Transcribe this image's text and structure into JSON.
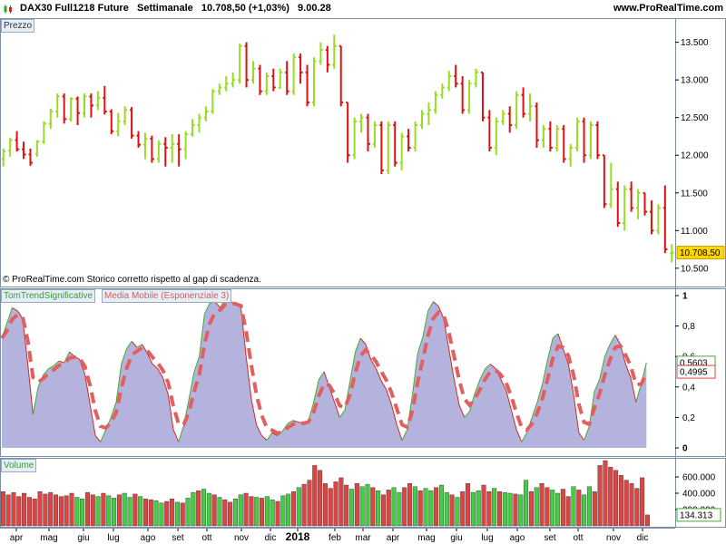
{
  "header": {
    "instrument": "DAX30 Full1218 Future",
    "timeframe": "Settimanale",
    "last": "10.708,50 (+1,03%)",
    "time": "9.00.28",
    "site": "www.ProRealTime.com"
  },
  "panels": {
    "price_label": "Prezzo",
    "note": "© ProRealTime.com  Storico corretto rispetto al gap di scadenza.",
    "indicator_label": "TomTrendSignificative",
    "ma_label": "Media Mobile (Esponenziale 3)",
    "volume_label": "Volume"
  },
  "colors": {
    "up": "#99dd22",
    "down": "#dd1111",
    "area": "#b3b3dd",
    "ma": "#e06060",
    "vol_up": "#44cc44",
    "vol_down": "#dd4444"
  },
  "chart_data": [
    {
      "type": "ohlc",
      "name": "Prezzo",
      "ylim": [
        10450,
        13700
      ],
      "yticks": [
        "13.500",
        "13.000",
        "12.500",
        "12.000",
        "11.500",
        "11.000",
        "10.500"
      ],
      "ytick_values": [
        13500,
        13000,
        12500,
        12000,
        11500,
        11000,
        10500
      ],
      "last_label": "10.708,50",
      "last_value": 10708.5,
      "x_labels": [
        "apr",
        "mag",
        "giu",
        "lug",
        "ago",
        "set",
        "ott",
        "nov",
        "dic",
        "2018",
        "feb",
        "mar",
        "apr",
        "mag",
        "giu",
        "lug",
        "ago",
        "set",
        "ott",
        "nov",
        "dic"
      ],
      "ohlc": [
        [
          11950,
          12090,
          11850,
          12050
        ],
        [
          12060,
          12230,
          11980,
          12200
        ],
        [
          12200,
          12320,
          12050,
          12080
        ],
        [
          12080,
          12180,
          11950,
          12010
        ],
        [
          12010,
          12090,
          11860,
          11900
        ],
        [
          12020,
          12200,
          11980,
          12180
        ],
        [
          12180,
          12450,
          12150,
          12420
        ],
        [
          12420,
          12620,
          12350,
          12580
        ],
        [
          12580,
          12820,
          12500,
          12780
        ],
        [
          12780,
          12820,
          12420,
          12480
        ],
        [
          12480,
          12770,
          12450,
          12750
        ],
        [
          12750,
          12780,
          12400,
          12560
        ],
        [
          12560,
          12820,
          12500,
          12780
        ],
        [
          12780,
          12820,
          12500,
          12660
        ],
        [
          12660,
          12850,
          12600,
          12760
        ],
        [
          12760,
          12920,
          12540,
          12580
        ],
        [
          12580,
          12610,
          12280,
          12320
        ],
        [
          12320,
          12560,
          12250,
          12450
        ],
        [
          12450,
          12650,
          12400,
          12600
        ],
        [
          12600,
          12640,
          12220,
          12260
        ],
        [
          12260,
          12320,
          12100,
          12140
        ],
        [
          12140,
          12300,
          11950,
          12220
        ],
        [
          12220,
          12260,
          11900,
          11950
        ],
        [
          11950,
          12200,
          11900,
          12150
        ],
        [
          12150,
          12240,
          11850,
          12100
        ],
        [
          12100,
          12280,
          11900,
          12150
        ],
        [
          12150,
          12280,
          11850,
          12080
        ],
        [
          12080,
          12320,
          11950,
          12280
        ],
        [
          12280,
          12480,
          12250,
          12400
        ],
        [
          12400,
          12550,
          12300,
          12500
        ],
        [
          12500,
          12650,
          12450,
          12580
        ],
        [
          12580,
          12880,
          12550,
          12850
        ],
        [
          12850,
          12950,
          12800,
          12900
        ],
        [
          12900,
          13050,
          12850,
          12950
        ],
        [
          12950,
          13100,
          12900,
          13000
        ],
        [
          13000,
          13480,
          12950,
          13450
        ],
        [
          13450,
          13500,
          12900,
          13000
        ],
        [
          13000,
          13250,
          12950,
          13150
        ],
        [
          13150,
          13200,
          12800,
          12850
        ],
        [
          12850,
          13100,
          12800,
          13050
        ],
        [
          13050,
          13150,
          12850,
          12900
        ],
        [
          12900,
          13150,
          12880,
          13100
        ],
        [
          13100,
          13250,
          12800,
          12850
        ],
        [
          12850,
          13350,
          12800,
          13300
        ],
        [
          13300,
          13350,
          12950,
          13100
        ],
        [
          13100,
          13200,
          12650,
          12700
        ],
        [
          12700,
          13300,
          12650,
          13250
        ],
        [
          13250,
          13500,
          13200,
          13400
        ],
        [
          13400,
          13450,
          13100,
          13200
        ],
        [
          13200,
          13600,
          13150,
          13450
        ],
        [
          13450,
          13450,
          12650,
          12700
        ],
        [
          12700,
          12700,
          11900,
          12000
        ],
        [
          12000,
          12500,
          11950,
          12450
        ],
        [
          12450,
          12550,
          12300,
          12500
        ],
        [
          12500,
          12550,
          12050,
          12150
        ],
        [
          12150,
          12450,
          12100,
          12400
        ],
        [
          12400,
          12450,
          11750,
          11800
        ],
        [
          11800,
          12450,
          11750,
          12400
        ],
        [
          12400,
          12450,
          11850,
          11900
        ],
        [
          11900,
          12300,
          11800,
          12250
        ],
        [
          12250,
          12350,
          12050,
          12100
        ],
        [
          12100,
          12450,
          12050,
          12400
        ],
        [
          12400,
          12600,
          12350,
          12550
        ],
        [
          12550,
          12700,
          12400,
          12600
        ],
        [
          12600,
          12850,
          12550,
          12800
        ],
        [
          12800,
          12950,
          12750,
          12900
        ],
        [
          12900,
          13120,
          12850,
          13050
        ],
        [
          13050,
          13200,
          12900,
          12950
        ],
        [
          12950,
          13050,
          12550,
          12600
        ],
        [
          12600,
          13000,
          12550,
          12950
        ],
        [
          12950,
          13150,
          12900,
          13100
        ],
        [
          13100,
          13100,
          12450,
          12500
        ],
        [
          12500,
          12600,
          12050,
          12100
        ],
        [
          12100,
          12500,
          12000,
          12450
        ],
        [
          12450,
          12600,
          12400,
          12550
        ],
        [
          12550,
          12650,
          12300,
          12400
        ],
        [
          12400,
          12850,
          12350,
          12800
        ],
        [
          12800,
          12900,
          12500,
          12550
        ],
        [
          12550,
          12820,
          12450,
          12650
        ],
        [
          12650,
          12700,
          12100,
          12200
        ],
        [
          12200,
          12400,
          12100,
          12350
        ],
        [
          12350,
          12450,
          12050,
          12100
        ],
        [
          12100,
          12400,
          12050,
          12350
        ],
        [
          12350,
          12400,
          11900,
          11950
        ],
        [
          11950,
          12150,
          11850,
          12100
        ],
        [
          12100,
          12500,
          12050,
          12450
        ],
        [
          12450,
          12500,
          11900,
          12000
        ],
        [
          12000,
          12450,
          11950,
          12400
        ],
        [
          12400,
          12450,
          11950,
          12000
        ],
        [
          12000,
          12000,
          11300,
          11350
        ],
        [
          11350,
          11900,
          11300,
          11550
        ],
        [
          11550,
          11650,
          11050,
          11100
        ],
        [
          11100,
          11600,
          11000,
          11550
        ],
        [
          11550,
          11650,
          11250,
          11300
        ],
        [
          11300,
          11550,
          11150,
          11500
        ],
        [
          11500,
          11500,
          11200,
          11250
        ],
        [
          11250,
          11400,
          10950,
          11000
        ],
        [
          11000,
          11350,
          10950,
          11300
        ],
        [
          11300,
          11600,
          10700,
          10750
        ],
        [
          10700,
          10820,
          10580,
          10708.5
        ]
      ]
    },
    {
      "type": "area",
      "name": "TomTrendSignificative",
      "ylim": [
        0,
        1
      ],
      "yticks": [
        "1",
        "0,8",
        "0,6",
        "0,4",
        "0,2",
        "0"
      ],
      "ytick_values": [
        1,
        0.8,
        0.6,
        0.4,
        0.2,
        0
      ],
      "last_label": "0,5603",
      "last_value": 0.5603,
      "values": [
        0.72,
        0.82,
        0.92,
        0.9,
        0.85,
        0.55,
        0.22,
        0.4,
        0.48,
        0.52,
        0.54,
        0.57,
        0.56,
        0.63,
        0.6,
        0.58,
        0.48,
        0.28,
        0.08,
        0.04,
        0.12,
        0.2,
        0.3,
        0.55,
        0.65,
        0.7,
        0.66,
        0.68,
        0.62,
        0.55,
        0.52,
        0.46,
        0.35,
        0.12,
        0.04,
        0.15,
        0.32,
        0.5,
        0.6,
        0.88,
        0.95,
        0.96,
        0.92,
        0.98,
        0.96,
        0.94,
        0.92,
        0.6,
        0.32,
        0.15,
        0.08,
        0.05,
        0.1,
        0.08,
        0.11,
        0.16,
        0.18,
        0.17,
        0.16,
        0.18,
        0.3,
        0.45,
        0.5,
        0.4,
        0.3,
        0.2,
        0.25,
        0.44,
        0.63,
        0.72,
        0.68,
        0.58,
        0.52,
        0.44,
        0.38,
        0.28,
        0.15,
        0.05,
        0.12,
        0.35,
        0.62,
        0.73,
        0.9,
        0.96,
        0.93,
        0.85,
        0.65,
        0.45,
        0.28,
        0.2,
        0.24,
        0.36,
        0.45,
        0.52,
        0.55,
        0.52,
        0.45,
        0.38,
        0.25,
        0.12,
        0.04,
        0.1,
        0.2,
        0.3,
        0.42,
        0.58,
        0.72,
        0.75,
        0.65,
        0.55,
        0.35,
        0.1,
        0.05,
        0.14,
        0.37,
        0.45,
        0.6,
        0.68,
        0.74,
        0.68,
        0.55,
        0.46,
        0.3,
        0.42,
        0.56
      ],
      "ma_last_label": "0,4995",
      "ma_last_value": 0.4995
    },
    {
      "type": "bar",
      "name": "Volume",
      "ylim": [
        0,
        800000
      ],
      "yticks": [
        "600.000",
        "400.000",
        "200.000"
      ],
      "ytick_values": [
        600000,
        400000,
        200000
      ],
      "last_label": "134.313",
      "last_value": 134313,
      "values": [
        420000,
        380000,
        410000,
        360000,
        400000,
        350000,
        330000,
        420000,
        390000,
        410000,
        380000,
        360000,
        370000,
        400000,
        350000,
        330000,
        410000,
        380000,
        360000,
        400000,
        370000,
        340000,
        380000,
        400000,
        350000,
        390000,
        360000,
        330000,
        320000,
        310000,
        280000,
        300000,
        330000,
        290000,
        280000,
        340000,
        410000,
        430000,
        450000,
        400000,
        380000,
        350000,
        320000,
        290000,
        330000,
        380000,
        400000,
        360000,
        350000,
        340000,
        360000,
        320000,
        300000,
        370000,
        390000,
        420000,
        470000,
        510000,
        560000,
        740000,
        680000,
        520000,
        460000,
        540000,
        590000,
        500000,
        450000,
        520000,
        480000,
        510000,
        470000,
        430000,
        380000,
        440000,
        470000,
        410000,
        470000,
        520000,
        480000,
        430000,
        460000,
        430000,
        470000,
        500000,
        410000,
        380000,
        350000,
        420000,
        520000,
        410000,
        430000,
        500000,
        420000,
        460000,
        420000,
        410000,
        400000,
        390000,
        380000,
        560000,
        420000,
        470000,
        520000,
        470000,
        440000,
        400000,
        450000,
        360000,
        480000,
        440000,
        380000,
        480000,
        420000,
        740000,
        800000,
        720000,
        680000,
        620000,
        560000,
        520000,
        460000,
        590000,
        134313
      ]
    }
  ]
}
